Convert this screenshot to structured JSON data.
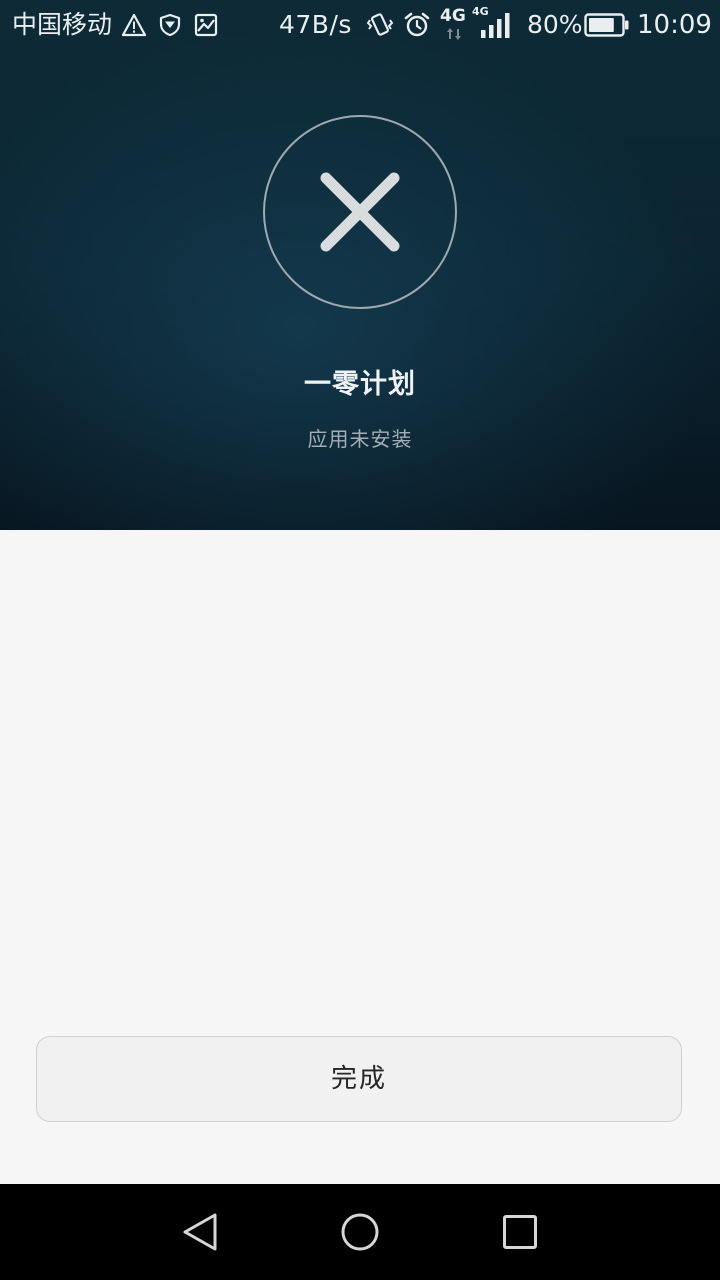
{
  "status_bar": {
    "carrier": "中国移动",
    "net_speed": "47B/s",
    "network_type_1": "4G",
    "network_type_2": "4G",
    "battery_percent": "80%",
    "battery_level": 0.8,
    "time": "10:09",
    "icons": [
      "warning-icon",
      "shield-icon",
      "image-icon",
      "vibrate-icon",
      "alarm-icon",
      "4g-data-icon",
      "4g-signal-icon",
      "battery-icon"
    ]
  },
  "result": {
    "app_name": "一零计划",
    "status": "应用未安装",
    "icon": "close-icon"
  },
  "actions": {
    "done_label": "完成"
  },
  "nav_bar": {
    "icons": [
      "back-icon",
      "home-icon",
      "recent-apps-icon"
    ]
  },
  "colors": {
    "header_bg": "#0b2532",
    "page_bg": "#f6f6f6",
    "button_bg": "#f1f1f1",
    "nav_bg": "#000000"
  }
}
